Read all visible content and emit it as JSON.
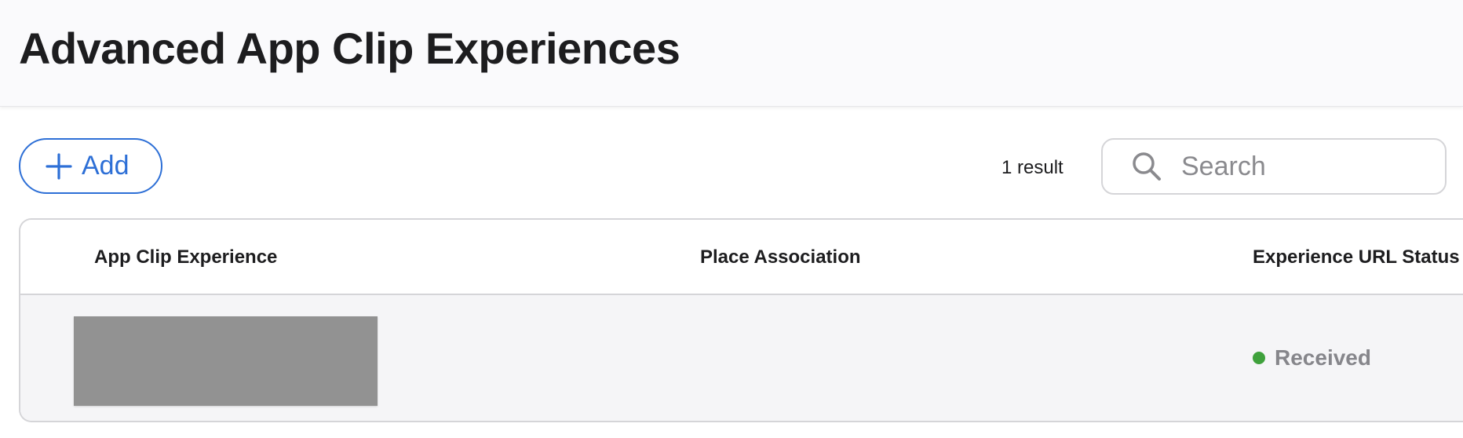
{
  "header": {
    "title": "Advanced App Clip Experiences"
  },
  "toolbar": {
    "add_label": "Add",
    "result_count": "1 result",
    "search": {
      "placeholder": "Search",
      "value": ""
    }
  },
  "table": {
    "columns": [
      "App Clip Experience",
      "Place Association",
      "Experience URL Status"
    ],
    "rows": [
      {
        "experience": "",
        "place_association": "",
        "status": "Received",
        "status_color": "#3fa13c"
      }
    ]
  },
  "colors": {
    "accent": "#2d6fd6",
    "status_received": "#3fa13c",
    "header_bg": "#fafafc",
    "row_bg": "#f5f5f7"
  },
  "icons": {
    "add": "plus-icon",
    "search": "search-icon"
  }
}
